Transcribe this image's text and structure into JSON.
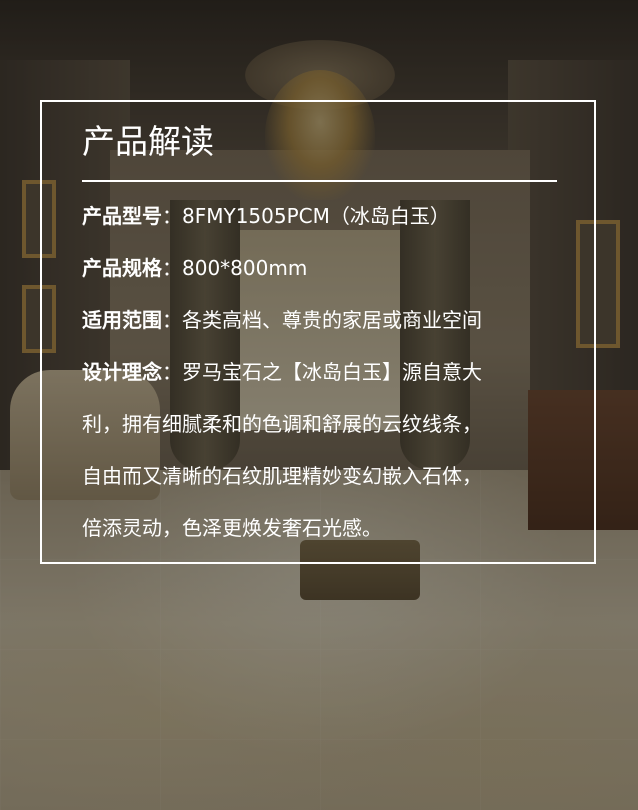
{
  "panel": {
    "title": "产品解读",
    "rows": [
      {
        "label": "产品型号",
        "separator": "：",
        "value": "8FMY1505PCM（冰岛白玉）"
      },
      {
        "label": "产品规格",
        "separator": "：",
        "value": "800*800mm"
      },
      {
        "label": "适用范围",
        "separator": "：",
        "value": "各类高档、尊贵的家居或商业空间"
      },
      {
        "label": "设计理念",
        "separator": "：",
        "value": "罗马宝石之【冰岛白玉】源自意大"
      }
    ],
    "description_lines": [
      "利，拥有细腻柔和的色调和舒展的云纹线条，",
      "自由而又清晰的石纹肌理精妙变幻嵌入石体，",
      "倍添灵动，色泽更焕发奢石光感。"
    ]
  },
  "colors": {
    "text": "#ffffff",
    "border": "#ffffff",
    "overlay": "rgba(20,16,12,0.42)"
  }
}
